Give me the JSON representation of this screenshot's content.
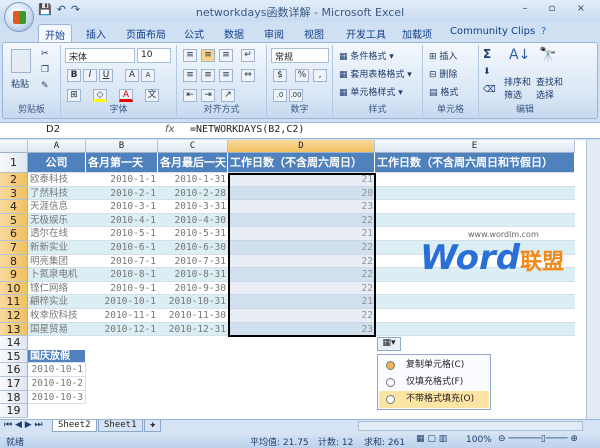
{
  "window": {
    "title": "networkdays函数详解 - Microsoft Excel",
    "controls": "– ▫ ×"
  },
  "qat": {
    "save": "💾",
    "undo": "↶",
    "redo": "↷"
  },
  "tabs": [
    "开始",
    "插入",
    "页面布局",
    "公式",
    "数据",
    "审阅",
    "视图",
    "开发工具",
    "加载项",
    "Community Clips"
  ],
  "ribbon": {
    "clipboard": {
      "paste": "粘贴",
      "label": "剪贴板"
    },
    "font": {
      "name": "宋体",
      "size": "10",
      "bold": "B",
      "italic": "I",
      "underline": "U",
      "grow": "A",
      "shrink": "A",
      "label": "字体"
    },
    "align": {
      "label": "对齐方式"
    },
    "number": {
      "format": "常规",
      "percent": "%",
      "comma": ",",
      "label": "数字"
    },
    "styles": {
      "cond": "条件格式",
      "table": "套用表格格式",
      "cell": "单元格样式",
      "label": "样式"
    },
    "cells": {
      "insert": "插入",
      "delete": "删除",
      "format": "格式",
      "label": "单元格"
    },
    "edit": {
      "sum": "Σ",
      "sort1": "排序和",
      "sort2": "筛选",
      "find1": "查找和",
      "find2": "选择",
      "label": "编辑"
    }
  },
  "formula_bar": {
    "name_box": "D2",
    "fx": "fx",
    "formula": "=NETWORKDAYS(B2,C2)"
  },
  "columns": [
    "A",
    "B",
    "C",
    "D",
    "E"
  ],
  "headers": [
    "公司",
    "各月第一天",
    "各月最后一天",
    "工作日数（不含周六周日）",
    "工作日数（不含周六周日和节假日）"
  ],
  "rows": [
    [
      "欧泰科技",
      "2010-1-1",
      "2010-1-31",
      "21"
    ],
    [
      "了然科技",
      "2010-2-1",
      "2010-2-28",
      "20"
    ],
    [
      "天涯信息",
      "2010-3-1",
      "2010-3-31",
      "23"
    ],
    [
      "无极娱乐",
      "2010-4-1",
      "2010-4-30",
      "22"
    ],
    [
      "透尔在线",
      "2010-5-1",
      "2010-5-31",
      "21"
    ],
    [
      "新新实业",
      "2010-6-1",
      "2010-6-30",
      "22"
    ],
    [
      "明亮集团",
      "2010-7-1",
      "2010-7-31",
      "22"
    ],
    [
      "卜氮泉电机",
      "2010-8-1",
      "2010-8-31",
      "22"
    ],
    [
      "铿仁网络",
      "2010-9-1",
      "2010-9-30",
      "22"
    ],
    [
      "翩梓实业",
      "2010-10-1",
      "2010-10-31",
      "21"
    ],
    [
      "枚幸欣科技",
      "2010-11-1",
      "2010-11-30",
      "22"
    ],
    [
      "国星贸易",
      "2010-12-1",
      "2010-12-31",
      "23"
    ]
  ],
  "holiday": {
    "title": "国庆放假",
    "dates": [
      "2010-10-1",
      "2010-10-2",
      "2010-10-3"
    ]
  },
  "row_numbers": [
    "1",
    "2",
    "3",
    "4",
    "5",
    "6",
    "7",
    "8",
    "9",
    "10",
    "11",
    "12",
    "13",
    "14",
    "15",
    "16",
    "17",
    "18",
    "19"
  ],
  "watermark": {
    "brand": "Word",
    "cn": "联盟",
    "url": "www.wordlm.com"
  },
  "paste_options": {
    "button": "▦▾",
    "items": [
      "复制单元格(C)",
      "仅填充格式(F)",
      "不带格式填充(O)"
    ]
  },
  "sheets": [
    "Sheet2",
    "Sheet1"
  ],
  "status": {
    "ready": "就绪",
    "average": "平均值: 21.75",
    "count": "计数: 12",
    "sum": "求和: 261",
    "zoom": "100%"
  }
}
